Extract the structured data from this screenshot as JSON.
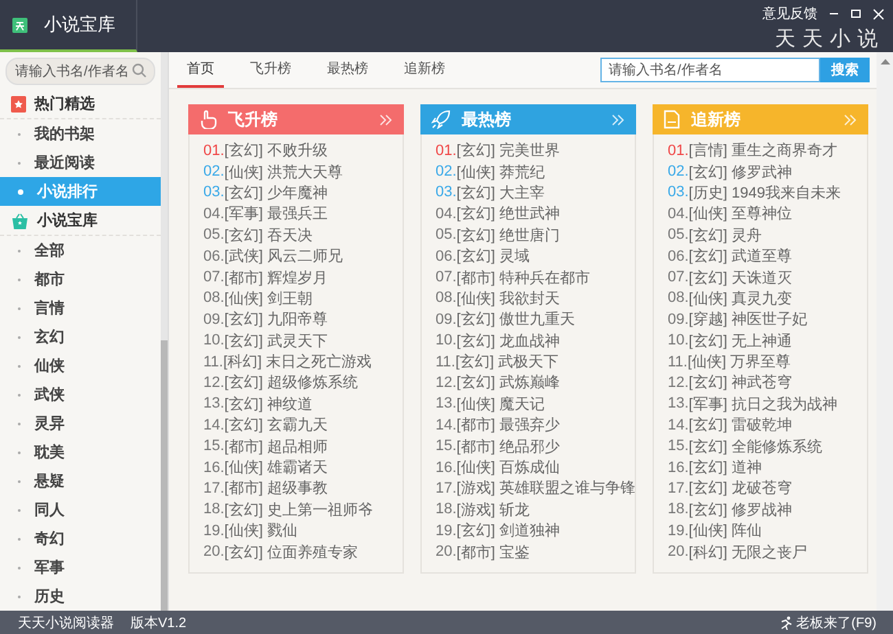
{
  "window": {
    "title": "小说宝库",
    "feedback": "意见反馈",
    "logo": "天天小说"
  },
  "sidebar": {
    "search": {
      "placeholder": "请输入书名/作者名"
    },
    "sections": [
      {
        "title": "热门精选",
        "kind": "hot",
        "items": [
          {
            "label": "我的书架",
            "selected": false
          },
          {
            "label": "最近阅读",
            "selected": false
          },
          {
            "label": "小说排行",
            "selected": true
          }
        ]
      },
      {
        "title": "小说宝库",
        "kind": "store",
        "items": [
          {
            "label": "全部",
            "selected": false
          },
          {
            "label": "都市",
            "selected": false
          },
          {
            "label": "言情",
            "selected": false
          },
          {
            "label": "玄幻",
            "selected": false
          },
          {
            "label": "仙侠",
            "selected": false
          },
          {
            "label": "武侠",
            "selected": false
          },
          {
            "label": "灵异",
            "selected": false
          },
          {
            "label": "耽美",
            "selected": false
          },
          {
            "label": "悬疑",
            "selected": false
          },
          {
            "label": "同人",
            "selected": false
          },
          {
            "label": "奇幻",
            "selected": false
          },
          {
            "label": "军事",
            "selected": false
          },
          {
            "label": "历史",
            "selected": false
          }
        ]
      }
    ]
  },
  "tabs": [
    {
      "label": "首页",
      "selected": true
    },
    {
      "label": "飞升榜",
      "selected": false
    },
    {
      "label": "最热榜",
      "selected": false
    },
    {
      "label": "追新榜",
      "selected": false
    }
  ],
  "search": {
    "placeholder": "请输入书名/作者名",
    "button": "搜索"
  },
  "rankings": [
    {
      "title": "飞升榜",
      "kind": "hand",
      "color": "#f46c6c",
      "entries": [
        {
          "rank": "01.",
          "text": "[玄幻] 不败升级"
        },
        {
          "rank": "02.",
          "text": "[仙侠] 洪荒大天尊"
        },
        {
          "rank": "03.",
          "text": "[玄幻] 少年魔神"
        },
        {
          "rank": "04.",
          "text": "[军事] 最强兵王"
        },
        {
          "rank": "05.",
          "text": "[玄幻] 吞天决"
        },
        {
          "rank": "06.",
          "text": "[武侠] 风云二师兄"
        },
        {
          "rank": "07.",
          "text": "[都市] 辉煌岁月"
        },
        {
          "rank": "08.",
          "text": "[仙侠] 剑王朝"
        },
        {
          "rank": "09.",
          "text": "[玄幻] 九阳帝尊"
        },
        {
          "rank": "10.",
          "text": "[玄幻] 武灵天下"
        },
        {
          "rank": "11.",
          "text": "[科幻] 末日之死亡游戏"
        },
        {
          "rank": "12.",
          "text": "[玄幻] 超级修炼系统"
        },
        {
          "rank": "13.",
          "text": "[玄幻] 神纹道"
        },
        {
          "rank": "14.",
          "text": "[玄幻] 玄霸九天"
        },
        {
          "rank": "15.",
          "text": "[都市] 超品相师"
        },
        {
          "rank": "16.",
          "text": "[仙侠] 雄霸诸天"
        },
        {
          "rank": "17.",
          "text": "[都市] 超级事教"
        },
        {
          "rank": "18.",
          "text": "[玄幻] 史上第一祖师爷"
        },
        {
          "rank": "19.",
          "text": "[仙侠] 戮仙"
        },
        {
          "rank": "20.",
          "text": "[玄幻] 位面养殖专家"
        }
      ]
    },
    {
      "title": "最热榜",
      "kind": "rocket",
      "color": "#2fa3e0",
      "entries": [
        {
          "rank": "01.",
          "text": "[玄幻] 完美世界"
        },
        {
          "rank": "02.",
          "text": "[仙侠] 莽荒纪"
        },
        {
          "rank": "03.",
          "text": "[玄幻] 大主宰"
        },
        {
          "rank": "04.",
          "text": "[玄幻] 绝世武神"
        },
        {
          "rank": "05.",
          "text": "[玄幻] 绝世唐门"
        },
        {
          "rank": "06.",
          "text": "[玄幻] 灵域"
        },
        {
          "rank": "07.",
          "text": "[都市] 特种兵在都市"
        },
        {
          "rank": "08.",
          "text": "[仙侠] 我欲封天"
        },
        {
          "rank": "09.",
          "text": "[玄幻] 傲世九重天"
        },
        {
          "rank": "10.",
          "text": "[玄幻] 龙血战神"
        },
        {
          "rank": "11.",
          "text": "[玄幻] 武极天下"
        },
        {
          "rank": "12.",
          "text": "[玄幻] 武炼巅峰"
        },
        {
          "rank": "13.",
          "text": "[仙侠] 魔天记"
        },
        {
          "rank": "14.",
          "text": "[都市] 最强弃少"
        },
        {
          "rank": "15.",
          "text": "[都市] 绝品邪少"
        },
        {
          "rank": "16.",
          "text": "[仙侠] 百炼成仙"
        },
        {
          "rank": "17.",
          "text": "[游戏] 英雄联盟之谁与争锋"
        },
        {
          "rank": "18.",
          "text": "[游戏] 斩龙"
        },
        {
          "rank": "19.",
          "text": "[玄幻] 剑道独神"
        },
        {
          "rank": "20.",
          "text": "[都市] 宝鉴"
        }
      ]
    },
    {
      "title": "追新榜",
      "kind": "page",
      "color": "#f6b52b",
      "entries": [
        {
          "rank": "01.",
          "text": "[言情] 重生之商界奇才"
        },
        {
          "rank": "02.",
          "text": "[玄幻] 修罗武神"
        },
        {
          "rank": "03.",
          "text": "[历史] 1949我来自未来"
        },
        {
          "rank": "04.",
          "text": "[仙侠] 至尊神位"
        },
        {
          "rank": "05.",
          "text": "[玄幻] 灵舟"
        },
        {
          "rank": "06.",
          "text": "[玄幻] 武道至尊"
        },
        {
          "rank": "07.",
          "text": "[玄幻] 天诛道灭"
        },
        {
          "rank": "08.",
          "text": "[仙侠] 真灵九变"
        },
        {
          "rank": "09.",
          "text": "[穿越] 神医世子妃"
        },
        {
          "rank": "10.",
          "text": "[玄幻] 无上神通"
        },
        {
          "rank": "11.",
          "text": "[仙侠] 万界至尊"
        },
        {
          "rank": "12.",
          "text": "[玄幻] 神武苍穹"
        },
        {
          "rank": "13.",
          "text": "[军事] 抗日之我为战神"
        },
        {
          "rank": "14.",
          "text": "[玄幻] 雷破乾坤"
        },
        {
          "rank": "15.",
          "text": "[玄幻] 全能修炼系统"
        },
        {
          "rank": "16.",
          "text": "[玄幻] 道神"
        },
        {
          "rank": "17.",
          "text": "[玄幻] 龙破苍穹"
        },
        {
          "rank": "18.",
          "text": "[玄幻] 修罗战神"
        },
        {
          "rank": "19.",
          "text": "[仙侠] 阵仙"
        },
        {
          "rank": "20.",
          "text": "[科幻] 无限之丧尸"
        }
      ]
    }
  ],
  "status_bar": {
    "app": "天天小说阅读器",
    "version": "版本V1.2",
    "boss_key": "老板来了(F9)"
  }
}
